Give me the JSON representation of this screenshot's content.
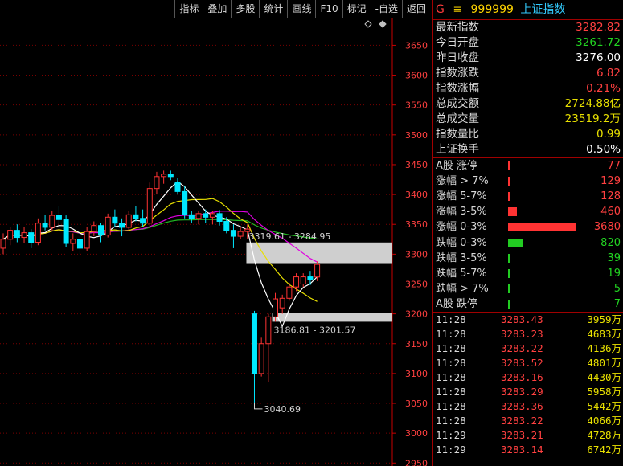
{
  "toolbar": [
    "指标",
    "叠加",
    "多股",
    "统计",
    "画线",
    "F10",
    "标记",
    "-自选",
    "返回"
  ],
  "header": {
    "flag": "G",
    "menu": "≡",
    "code": "999999",
    "name": "上证指数"
  },
  "quote": [
    {
      "label": "最新指数",
      "value": "3282.82",
      "color": "red"
    },
    {
      "label": "今日开盘",
      "value": "3261.72",
      "color": "grn"
    },
    {
      "label": "昨日收盘",
      "value": "3276.00",
      "color": "wht"
    },
    {
      "label": "指数涨跌",
      "value": "6.82",
      "color": "red"
    },
    {
      "label": "指数涨幅",
      "value": "0.21%",
      "color": "red"
    },
    {
      "label": "总成交额",
      "value": "2724.88亿",
      "color": "yel"
    },
    {
      "label": "总成交量",
      "value": "23519.2万",
      "color": "yel"
    },
    {
      "label": "指数量比",
      "value": "0.99",
      "color": "yel"
    },
    {
      "label": "上证换手",
      "value": "0.50%",
      "color": "wht"
    }
  ],
  "breadth_up": [
    {
      "label": "A股 涨停",
      "value": "77",
      "count": 77
    },
    {
      "label": "涨幅 > 7%",
      "value": "129",
      "count": 129
    },
    {
      "label": "涨幅 5-7%",
      "value": "128",
      "count": 128
    },
    {
      "label": "涨幅 3-5%",
      "value": "460",
      "count": 460
    },
    {
      "label": "涨幅 0-3%",
      "value": "3680",
      "count": 3680
    }
  ],
  "breadth_down": [
    {
      "label": "跌幅 0-3%",
      "value": "820",
      "count": 820
    },
    {
      "label": "跌幅 3-5%",
      "value": "39",
      "count": 39
    },
    {
      "label": "跌幅 5-7%",
      "value": "19",
      "count": 19
    },
    {
      "label": "跌幅 > 7%",
      "value": "5",
      "count": 5
    },
    {
      "label": "A股 跌停",
      "value": "7",
      "count": 7
    }
  ],
  "ticks": [
    {
      "time": "11:28",
      "price": "3283.43",
      "vol": "3959万"
    },
    {
      "time": "11:28",
      "price": "3283.23",
      "vol": "4683万"
    },
    {
      "time": "11:28",
      "price": "3283.22",
      "vol": "4136万"
    },
    {
      "time": "11:28",
      "price": "3283.52",
      "vol": "4801万"
    },
    {
      "time": "11:28",
      "price": "3283.16",
      "vol": "4430万"
    },
    {
      "time": "11:28",
      "price": "3283.29",
      "vol": "5958万"
    },
    {
      "time": "11:28",
      "price": "3283.36",
      "vol": "5442万"
    },
    {
      "time": "11:28",
      "price": "3283.22",
      "vol": "4066万"
    },
    {
      "time": "11:29",
      "price": "3283.21",
      "vol": "4728万"
    },
    {
      "time": "11:29",
      "price": "3283.14",
      "vol": "6742万"
    }
  ],
  "chart_data": {
    "type": "candlestick",
    "y_ticks": [
      "3650",
      "3600",
      "3550",
      "3500",
      "3450",
      "3400",
      "3350",
      "3300",
      "3250",
      "3200",
      "3150",
      "3100",
      "3050",
      "3000",
      "2950"
    ],
    "ylim": [
      2945,
      3695
    ],
    "grid": true,
    "annotations": [
      {
        "text": "3319.61 - 3284.95",
        "low": 3284.95,
        "high": 3319.61
      },
      {
        "text": "3186.81 - 3201.57",
        "low": 3186.81,
        "high": 3201.57
      },
      {
        "text": "3040.69",
        "value": 3040.69
      }
    ],
    "candles": [
      {
        "o": 3310,
        "h": 3335,
        "l": 3300,
        "c": 3325
      },
      {
        "o": 3325,
        "h": 3345,
        "l": 3315,
        "c": 3340
      },
      {
        "o": 3340,
        "h": 3350,
        "l": 3320,
        "c": 3328
      },
      {
        "o": 3328,
        "h": 3345,
        "l": 3318,
        "c": 3336
      },
      {
        "o": 3336,
        "h": 3342,
        "l": 3310,
        "c": 3320
      },
      {
        "o": 3320,
        "h": 3360,
        "l": 3315,
        "c": 3352
      },
      {
        "o": 3352,
        "h": 3366,
        "l": 3340,
        "c": 3345
      },
      {
        "o": 3345,
        "h": 3372,
        "l": 3340,
        "c": 3365
      },
      {
        "o": 3365,
        "h": 3380,
        "l": 3350,
        "c": 3358
      },
      {
        "o": 3358,
        "h": 3365,
        "l": 3312,
        "c": 3318
      },
      {
        "o": 3318,
        "h": 3335,
        "l": 3305,
        "c": 3325
      },
      {
        "o": 3325,
        "h": 3330,
        "l": 3300,
        "c": 3310
      },
      {
        "o": 3310,
        "h": 3345,
        "l": 3305,
        "c": 3338
      },
      {
        "o": 3338,
        "h": 3355,
        "l": 3330,
        "c": 3348
      },
      {
        "o": 3348,
        "h": 3352,
        "l": 3320,
        "c": 3332
      },
      {
        "o": 3332,
        "h": 3368,
        "l": 3328,
        "c": 3362
      },
      {
        "o": 3362,
        "h": 3375,
        "l": 3345,
        "c": 3352
      },
      {
        "o": 3352,
        "h": 3360,
        "l": 3330,
        "c": 3345
      },
      {
        "o": 3345,
        "h": 3372,
        "l": 3340,
        "c": 3366
      },
      {
        "o": 3366,
        "h": 3380,
        "l": 3355,
        "c": 3360
      },
      {
        "o": 3360,
        "h": 3375,
        "l": 3345,
        "c": 3352
      },
      {
        "o": 3352,
        "h": 3420,
        "l": 3348,
        "c": 3410
      },
      {
        "o": 3410,
        "h": 3438,
        "l": 3400,
        "c": 3430
      },
      {
        "o": 3430,
        "h": 3440,
        "l": 3418,
        "c": 3434
      },
      {
        "o": 3434,
        "h": 3440,
        "l": 3424,
        "c": 3430
      },
      {
        "o": 3420,
        "h": 3428,
        "l": 3400,
        "c": 3405
      },
      {
        "o": 3405,
        "h": 3415,
        "l": 3360,
        "c": 3366
      },
      {
        "o": 3366,
        "h": 3372,
        "l": 3352,
        "c": 3360
      },
      {
        "o": 3360,
        "h": 3372,
        "l": 3350,
        "c": 3368
      },
      {
        "o": 3368,
        "h": 3375,
        "l": 3352,
        "c": 3362
      },
      {
        "o": 3362,
        "h": 3372,
        "l": 3350,
        "c": 3368
      },
      {
        "o": 3368,
        "h": 3374,
        "l": 3348,
        "c": 3355
      },
      {
        "o": 3355,
        "h": 3362,
        "l": 3335,
        "c": 3340
      },
      {
        "o": 3340,
        "h": 3350,
        "l": 3310,
        "c": 3330
      },
      {
        "o": 3330,
        "h": 3345,
        "l": 3325,
        "c": 3338
      },
      {
        "o": 3338,
        "h": 3350,
        "l": 3325,
        "c": 3342
      },
      {
        "o": 3200,
        "h": 3205,
        "l": 3040.69,
        "c": 3100
      },
      {
        "o": 3100,
        "h": 3160,
        "l": 3095,
        "c": 3150
      },
      {
        "o": 3150,
        "h": 3200,
        "l": 3085,
        "c": 3195
      },
      {
        "o": 3195,
        "h": 3235,
        "l": 3186.81,
        "c": 3225
      },
      {
        "o": 3210,
        "h": 3232,
        "l": 3200,
        "c": 3226
      },
      {
        "o": 3226,
        "h": 3252,
        "l": 3222,
        "c": 3245
      },
      {
        "o": 3245,
        "h": 3268,
        "l": 3238,
        "c": 3262
      },
      {
        "o": 3250,
        "h": 3268,
        "l": 3245,
        "c": 3262
      },
      {
        "o": 3262,
        "h": 3272,
        "l": 3248,
        "c": 3258
      },
      {
        "o": 3261.72,
        "h": 3288,
        "l": 3255,
        "c": 3282.82
      }
    ]
  },
  "colors": {
    "up": "#ff3333",
    "down": "#00e8ff",
    "grid": "#7a0000",
    "axis": "#c80000",
    "ma_white": "#ffffff",
    "ma_yellow": "#e8e000",
    "ma_magenta": "#e000e0",
    "ma_green": "#22bb22"
  }
}
